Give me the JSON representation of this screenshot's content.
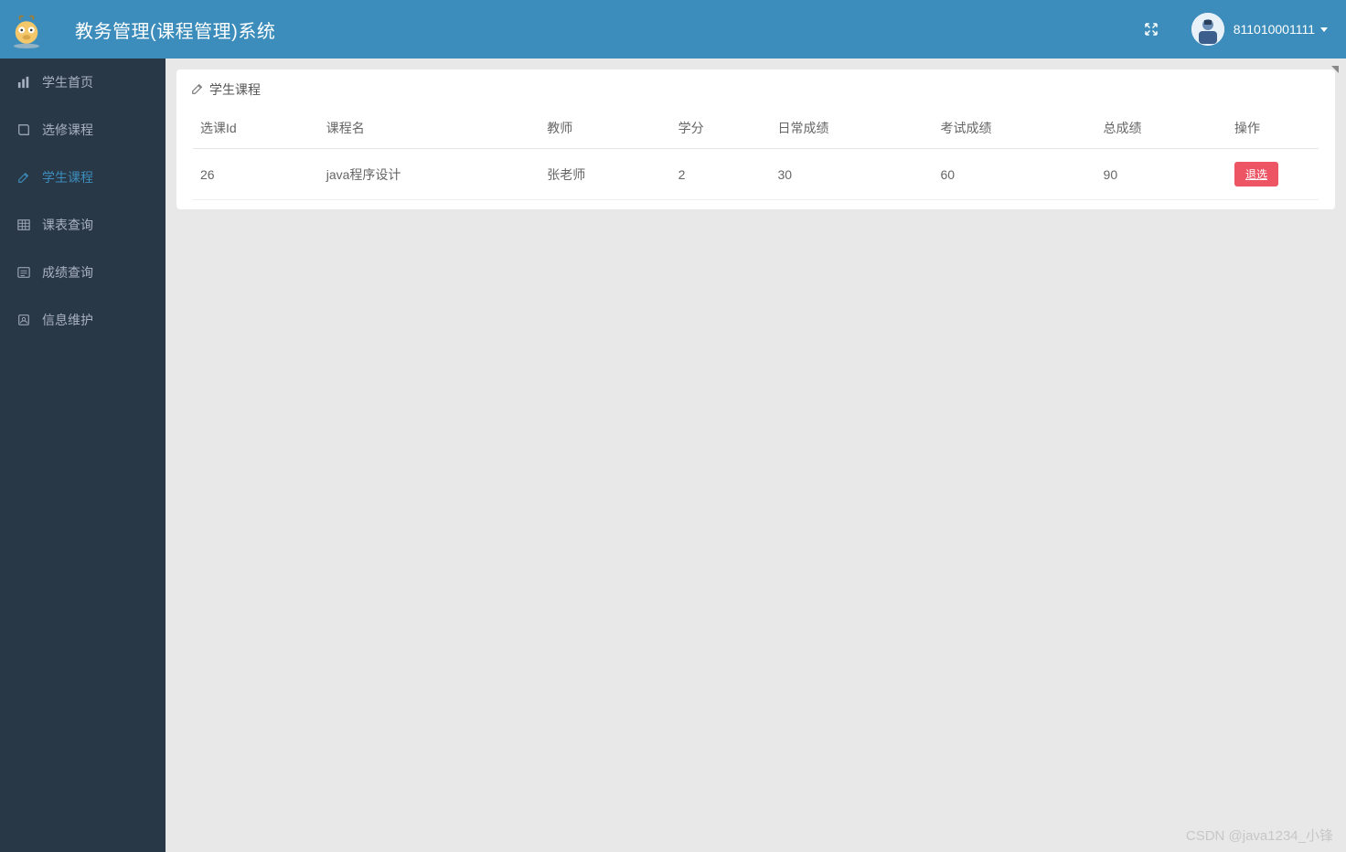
{
  "header": {
    "title": "教务管理(课程管理)系统",
    "username": "811010001111"
  },
  "sidebar": {
    "items": [
      {
        "label": "学生首页",
        "icon": "bar-chart-icon",
        "active": false
      },
      {
        "label": "选修课程",
        "icon": "book-icon",
        "active": false
      },
      {
        "label": "学生课程",
        "icon": "edit-icon",
        "active": true
      },
      {
        "label": "课表查询",
        "icon": "table-icon",
        "active": false
      },
      {
        "label": "成绩查询",
        "icon": "list-icon",
        "active": false
      },
      {
        "label": "信息维护",
        "icon": "profile-icon",
        "active": false
      }
    ]
  },
  "panel": {
    "title": "学生课程",
    "columns": [
      "选课Id",
      "课程名",
      "教师",
      "学分",
      "日常成绩",
      "考试成绩",
      "总成绩",
      "操作"
    ],
    "rows": [
      {
        "id": "26",
        "course": "java程序设计",
        "teacher": "张老师",
        "credit": "2",
        "daily": "30",
        "exam": "60",
        "total": "90",
        "action": "退选"
      }
    ]
  },
  "watermark": "CSDN @java1234_小锋"
}
